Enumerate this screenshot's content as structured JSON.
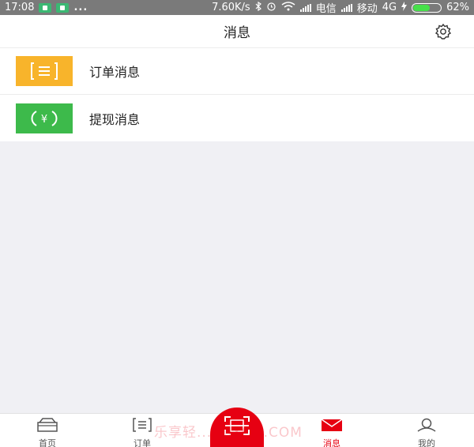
{
  "status_bar": {
    "time": "17:08",
    "dots": "...",
    "speed": "7.60K/s",
    "carrier1": "电信",
    "carrier2": "移动",
    "network": "4G",
    "battery_percent": "62%",
    "battery_level": 0.62
  },
  "header": {
    "title": "消息"
  },
  "messages": [
    {
      "label": "订单消息",
      "icon": "order-icon",
      "color": "#f8b42b"
    },
    {
      "label": "提现消息",
      "icon": "withdraw-yen-icon",
      "color": "#3dba4b"
    }
  ],
  "tabbar": {
    "home": "首页",
    "orders": "订单",
    "messages": "消息",
    "me": "我的",
    "accent": "#e60012"
  },
  "watermark": "乐享轻... NJYQH.COM"
}
